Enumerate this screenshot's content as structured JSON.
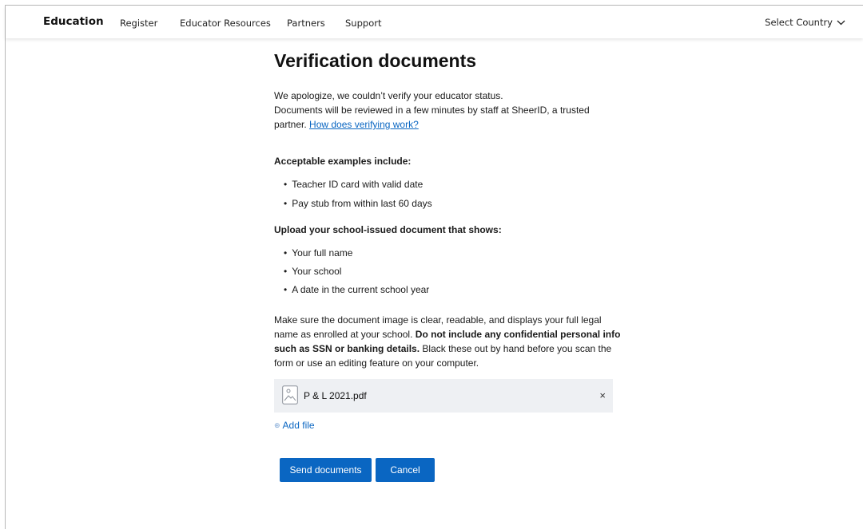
{
  "nav": {
    "brand": "Education",
    "links": [
      "Register",
      "Educator Resources",
      "Partners",
      "Support"
    ],
    "country_label": "Select Country"
  },
  "main": {
    "title": "Verification documents",
    "intro_line1": "We apologize, we couldn’t verify your educator status.",
    "intro_line2": "Documents will be reviewed in a few minutes by staff at SheerID, a trusted partner.",
    "intro_link": "How does verifying work?",
    "examples_title": "Acceptable examples include:",
    "examples": [
      "Teacher ID card with valid date",
      "Pay stub from within last 60 days"
    ],
    "upload_title": "Upload your school-issued document that shows:",
    "upload_items": [
      "Your full name",
      "Your school",
      "A date in the current school year"
    ],
    "notice_part1": "Make sure the document image is clear, readable, and displays your full legal name as enrolled at your school.",
    "notice_bold": "Do not include any confidential personal info such as SSN or banking details.",
    "notice_part2": "Black these out by hand before you scan the form or use an editing feature on your computer.",
    "file_name": "P & L 2021.pdf",
    "remove_symbol": "×",
    "add_file_label": "Add file",
    "send_label": "Send documents",
    "cancel_label": "Cancel"
  },
  "colors": {
    "accent": "#0a66c2",
    "file_row_bg": "#eef0f3"
  },
  "icons": {
    "file": "image-file-icon",
    "remove": "close-icon",
    "add": "add-circle-icon",
    "country": "chevron-down-icon"
  }
}
